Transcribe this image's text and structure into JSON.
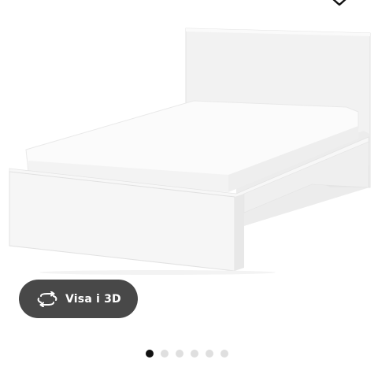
{
  "product": {
    "image_name": "bed-frame-white"
  },
  "favorite": {
    "icon": "heart-icon"
  },
  "view_3d": {
    "label": "Visa i 3D",
    "icon": "rotate-3d-icon",
    "button_color": "#484848"
  },
  "carousel": {
    "total": 6,
    "active_index": 0,
    "active_color": "#111111",
    "inactive_color": "#dfdfdf"
  }
}
